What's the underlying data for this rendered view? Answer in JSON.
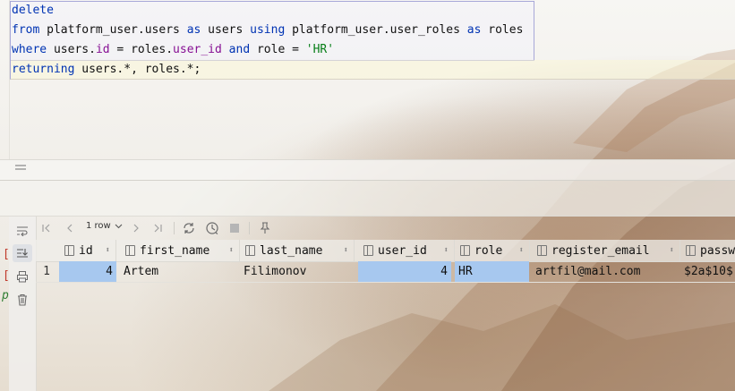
{
  "editor": {
    "lines": [
      [
        {
          "t": "delete",
          "c": "kw"
        }
      ],
      [
        {
          "t": "from",
          "c": "kw"
        },
        {
          "t": " platform_user.users ",
          "c": ""
        },
        {
          "t": "as",
          "c": "kw"
        },
        {
          "t": " users ",
          "c": ""
        },
        {
          "t": "using",
          "c": "kw"
        },
        {
          "t": " platform_user.user_roles ",
          "c": ""
        },
        {
          "t": "as",
          "c": "kw"
        },
        {
          "t": " roles",
          "c": ""
        }
      ],
      [
        {
          "t": "where",
          "c": "kw"
        },
        {
          "t": " users.",
          "c": ""
        },
        {
          "t": "id",
          "c": "fld"
        },
        {
          "t": " = roles.",
          "c": ""
        },
        {
          "t": "user_id",
          "c": "fld"
        },
        {
          "t": " ",
          "c": ""
        },
        {
          "t": "and",
          "c": "kw"
        },
        {
          "t": " role = ",
          "c": ""
        },
        {
          "t": "'HR'",
          "c": "str"
        }
      ],
      [
        {
          "t": "returning",
          "c": "kw"
        },
        {
          "t": " users.*, roles.*;",
          "c": ""
        }
      ]
    ]
  },
  "toolbar": {
    "rows_label": "1 row",
    "icons": [
      "first-page-icon",
      "prev-page-icon",
      "next-page-icon",
      "last-page-icon",
      "refresh-icon",
      "history-icon",
      "stop-icon",
      "pin-icon"
    ]
  },
  "side": {
    "marks": [
      "[",
      "[",
      "p"
    ],
    "icons": [
      "wrap-icon",
      "import-icon",
      "print-icon",
      "trash-icon"
    ]
  },
  "grid": {
    "columns": [
      "id",
      "first_name",
      "last_name",
      "user_id",
      "role",
      "register_email",
      "passw"
    ],
    "rows": [
      {
        "num": "1",
        "cells": [
          "4",
          "Artem",
          "Filimonov",
          "4",
          "HR",
          "artfil@mail.com",
          "$2a$10$"
        ]
      }
    ]
  }
}
